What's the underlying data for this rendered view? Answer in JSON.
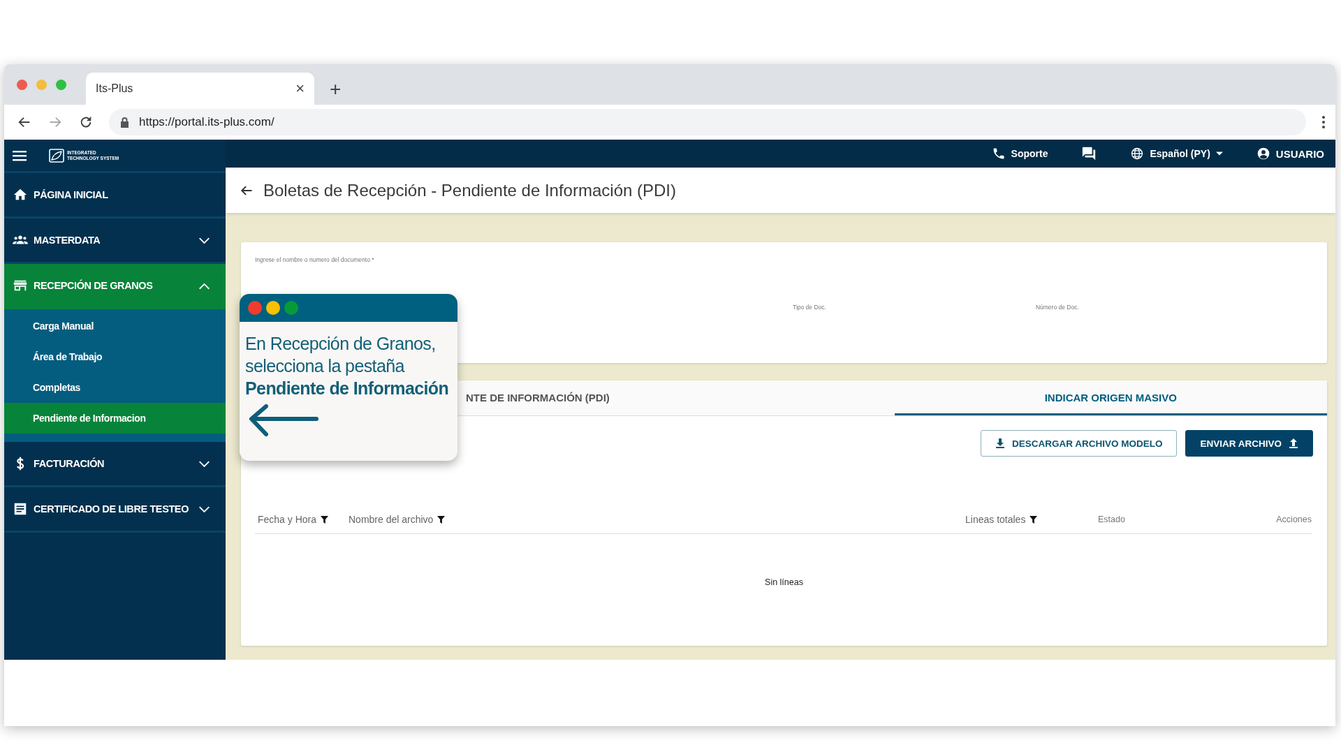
{
  "browser": {
    "tab_title": "Its-Plus",
    "tab_close": "×",
    "new_tab": "+",
    "url": "https://portal.its-plus.com/"
  },
  "topbar": {
    "logo_lines": [
      "INTEGRATED",
      "TECHNOLOGY SYSTEM"
    ],
    "support": "Soporte",
    "language": "Español (PY)",
    "user": "USUARIO"
  },
  "sidebar": {
    "items": [
      {
        "label": "PÁGINA INICIAL",
        "kind": "link",
        "selected": false
      },
      {
        "label": "MASTERDATA",
        "kind": "group",
        "expanded": false,
        "selected": false
      },
      {
        "label": "RECEPCIÓN DE GRANOS",
        "kind": "group",
        "expanded": true,
        "selected": true,
        "children": [
          {
            "label": "Carga Manual",
            "selected": false
          },
          {
            "label": "Área de Trabajo",
            "selected": false
          },
          {
            "label": "Completas",
            "selected": false
          },
          {
            "label": "Pendiente de Informacion",
            "selected": true
          }
        ]
      },
      {
        "label": "FACTURACIÓN",
        "kind": "group",
        "expanded": false,
        "selected": false
      },
      {
        "label": "CERTIFICADO DE LIBRE TESTEO",
        "kind": "group",
        "expanded": false,
        "selected": false
      }
    ]
  },
  "page": {
    "title": "Boletas de Recepción - Pendiente de Información (PDI)"
  },
  "search_form": {
    "label": "Ingrese el nombre o numero del documento *",
    "fields": [
      {
        "label": "Tipo de Doc."
      },
      {
        "label": "Número de Doc."
      }
    ]
  },
  "tabs": [
    {
      "label": "NTE DE INFORMACIÓN (PDI)",
      "selected": false
    },
    {
      "label": "INDICAR ORIGEN MASIVO",
      "selected": true
    }
  ],
  "buttons": [
    {
      "label": "DESCARGAR ARCHIVO MODELO",
      "kind": "outlined"
    },
    {
      "label": "ENVIAR ARCHIVO",
      "kind": "filled"
    }
  ],
  "table": {
    "columns": [
      {
        "label": "Fecha y Hora",
        "filterable": true
      },
      {
        "label": "Nombre del archivo",
        "filterable": true
      },
      {
        "label": "Lineas totales",
        "filterable": true
      },
      {
        "label": "Estado",
        "filterable": false
      },
      {
        "label": "Acciones",
        "filterable": false
      }
    ],
    "empty_message": "Sin líneas"
  },
  "callout": {
    "text": "En Recepción de Granos, selecciona la pestaña **Pendiente de Información**"
  }
}
